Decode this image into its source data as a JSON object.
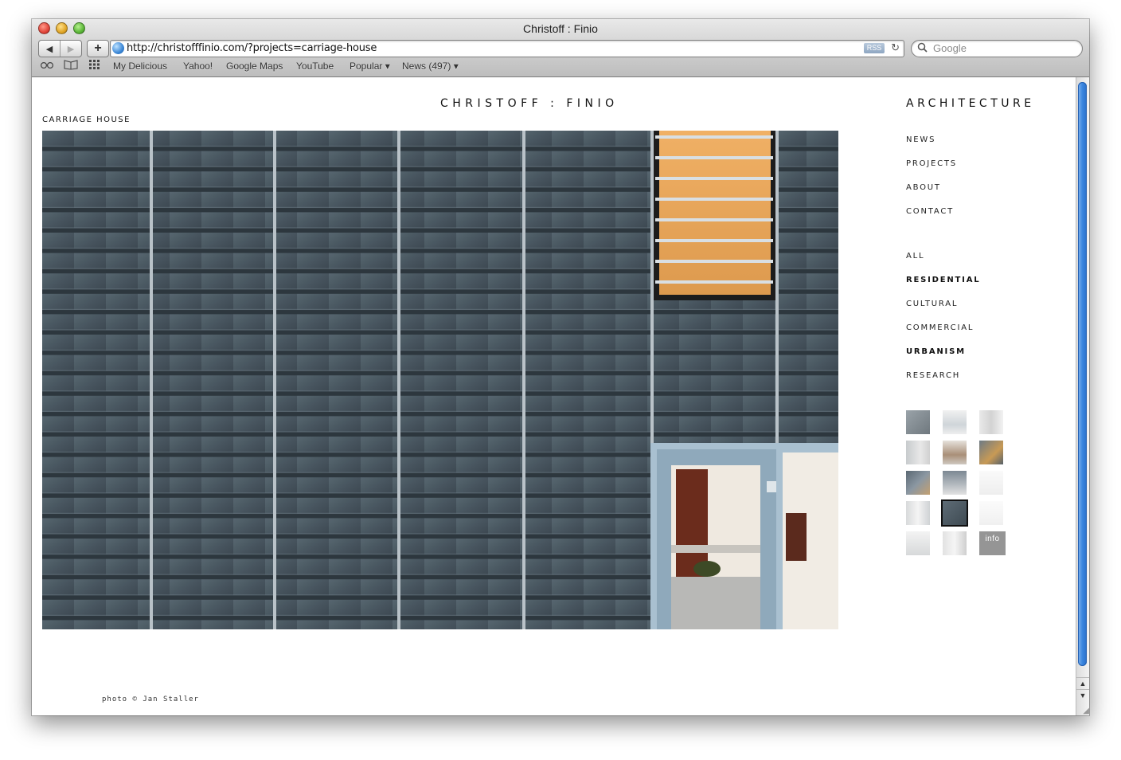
{
  "window": {
    "title": "Christoff : Finio"
  },
  "toolbar": {
    "back_icon": "back-arrow-icon",
    "forward_icon": "forward-arrow-icon",
    "add_icon": "plus-icon",
    "url": "http://christofffinio.com/?projects=carriage-house",
    "rss_label": "RSS",
    "search_placeholder": "Google"
  },
  "bookmarks": {
    "items": [
      "My Delicious",
      "Yahoo!",
      "Google Maps",
      "YouTube",
      "Popular ▾",
      "News (497) ▾"
    ]
  },
  "site": {
    "title": "CHRISTOFF : FINIO",
    "section_title": "ARCHITECTURE",
    "project_title": "CARRIAGE HOUSE",
    "nav": [
      "NEWS",
      "PROJECTS",
      "ABOUT",
      "CONTACT"
    ],
    "categories": [
      {
        "label": "ALL",
        "bold": false
      },
      {
        "label": "RESIDENTIAL",
        "bold": true
      },
      {
        "label": "CULTURAL",
        "bold": false
      },
      {
        "label": "COMMERCIAL",
        "bold": false
      },
      {
        "label": "URBANISM",
        "bold": true
      },
      {
        "label": "RESEARCH",
        "bold": false
      }
    ],
    "info_label": "info",
    "credit": "photo © Jan Staller"
  },
  "colors": {
    "slate": "#4c5a63",
    "louver_orange": "#e9a75b",
    "window_frame": "#9fb7c8",
    "interior_wood": "#6b2c1c"
  }
}
